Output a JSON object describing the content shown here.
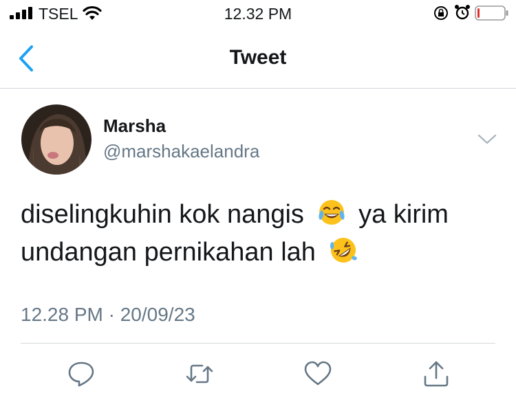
{
  "status_bar": {
    "carrier": "TSEL",
    "time": "12.32 PM",
    "icons": [
      "signal-icon",
      "wifi-icon",
      "orientation-lock-icon",
      "alarm-icon",
      "battery-icon"
    ],
    "battery_level": 0.08
  },
  "nav": {
    "title": "Tweet",
    "back_icon": "chevron-left-icon"
  },
  "tweet": {
    "author_name": "Marsha",
    "author_handle": "@marshakaelandra",
    "text_part1": "diselingkuhin kok nangis",
    "text_part2": "ya kirim undangan pernikahan lah",
    "emoji1": "tears-of-joy-emoji",
    "emoji2": "rolling-on-floor-laughing-emoji",
    "timestamp": "12.28 PM · 20/09/23"
  },
  "actions": [
    "reply-icon",
    "retweet-icon",
    "like-icon",
    "share-icon"
  ],
  "colors": {
    "accent": "#1da1f2",
    "secondary_text": "#657786",
    "divider": "#d4d7db",
    "battery_low": "#e0312b"
  }
}
